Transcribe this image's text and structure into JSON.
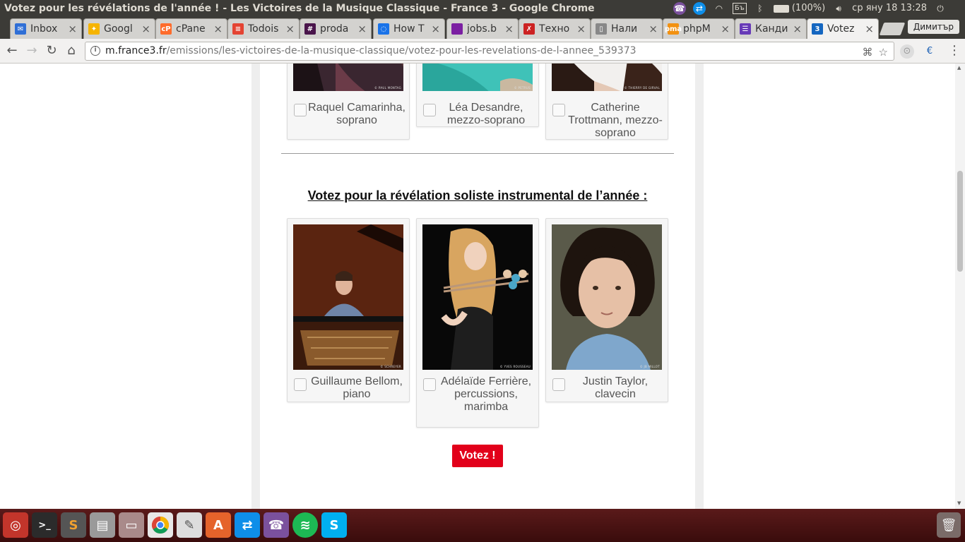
{
  "window": {
    "title": "Votez pour les révélations de l'année ! - Les Victoires de la Musique Classique - France 3 - Google Chrome"
  },
  "system_tray": {
    "keyboard": "Бъ",
    "battery": "(100%)",
    "clock": "ср яну 18 13:28"
  },
  "tabs": [
    {
      "label": "Inbox",
      "icon": "gmail-icon",
      "color": "#2f6fd6",
      "glyph": "✉"
    },
    {
      "label": "Googl",
      "icon": "google-keep-icon",
      "color": "#f6b400",
      "glyph": "✦"
    },
    {
      "label": "cPane",
      "icon": "cpanel-icon",
      "color": "#ff6c2c",
      "glyph": "cP"
    },
    {
      "label": "Todois",
      "icon": "todoist-icon",
      "color": "#e44332",
      "glyph": "≡"
    },
    {
      "label": "proda",
      "icon": "slack-icon",
      "color": "#4a154b",
      "glyph": "#"
    },
    {
      "label": "How T",
      "icon": "loading-icon",
      "color": "#1a73e8",
      "glyph": "◌"
    },
    {
      "label": "jobs.b",
      "icon": "jobs-icon",
      "color": "#7b1fa2",
      "glyph": ""
    },
    {
      "label": "Техно",
      "icon": "techno-icon",
      "color": "#cc2222",
      "glyph": "✗"
    },
    {
      "label": "Нали",
      "icon": "document-icon",
      "color": "#888888",
      "glyph": "▯"
    },
    {
      "label": "phpM",
      "icon": "phpmyadmin-icon",
      "color": "#f29111",
      "glyph": "pma"
    },
    {
      "label": "Канди",
      "icon": "forms-icon",
      "color": "#673ab7",
      "glyph": "☰"
    },
    {
      "label": "Votez",
      "icon": "france3-icon",
      "color": "#1466c0",
      "glyph": "3"
    }
  ],
  "profile": "Димитър",
  "address_bar": {
    "host": "m.france3.fr",
    "path": "/emissions/les-victoires-de-la-musique-classique/votez-pour-les-revelations-de-l-annee_539373"
  },
  "top_cards": [
    {
      "name": "Raquel Camarinha, soprano",
      "credit": "© PAUL MONTAG"
    },
    {
      "name": "Léa Desandre, mezzo-soprano",
      "credit": "© PETRUS"
    },
    {
      "name": "Catherine Trottmann, mezzo-soprano",
      "credit": "© THIERRY DE GIRVAL"
    }
  ],
  "section": {
    "title": "Votez pour la révélation soliste instrumental de l’année :"
  },
  "cards": [
    {
      "name": "Guillaume Bellom, piano",
      "credit": "© SCHREYER"
    },
    {
      "name": "Adélaïde Ferrière, percussions, marimba",
      "credit": "© YVES ROUSSEAU"
    },
    {
      "name": "Justin Taylor, clavecin",
      "credit": "© JB MILLOT"
    }
  ],
  "vote_button": "Votez !",
  "colors": {
    "vote": "#e2001a"
  }
}
